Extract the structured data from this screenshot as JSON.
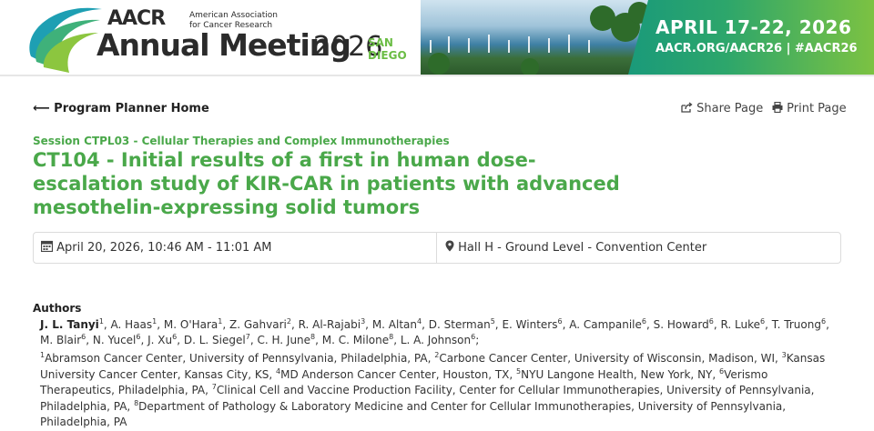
{
  "banner": {
    "org_short": "AACR",
    "org_full_line1": "American Association",
    "org_full_line2": "for Cancer Research",
    "meeting": "Annual Meeting",
    "year": "2026",
    "city_line1": "SAN",
    "city_line2": "DIEGO",
    "dates": "APRIL 17-22, 2026",
    "links": "AACR.ORG/AACR26  |  #AACR26"
  },
  "nav": {
    "home_label": "Program Planner Home",
    "share_label": "Share Page",
    "print_label": "Print Page"
  },
  "session": "Session CTPL03 - Cellular Therapies and Complex Immunotherapies",
  "title": "CT104 - Initial results of a first in human dose-escalation study of KIR-CAR in patients with advanced mesothelin-expressing solid tumors",
  "info": {
    "datetime": "April 20, 2026, 10:46 AM - 11:01 AM",
    "location": "Hall H - Ground Level - Convention Center"
  },
  "authors_heading": "Authors",
  "authors": [
    {
      "name": "J. L. Tanyi",
      "aff": "1"
    },
    {
      "name": "A. Haas",
      "aff": "1"
    },
    {
      "name": "M. O'Hara",
      "aff": "1"
    },
    {
      "name": "Z. Gahvari",
      "aff": "2"
    },
    {
      "name": "R. Al-Rajabi",
      "aff": "3"
    },
    {
      "name": "M. Altan",
      "aff": "4"
    },
    {
      "name": "D. Sterman",
      "aff": "5"
    },
    {
      "name": "E. Winters",
      "aff": "6"
    },
    {
      "name": "A. Campanile",
      "aff": "6"
    },
    {
      "name": "S. Howard",
      "aff": "6"
    },
    {
      "name": "R. Luke",
      "aff": "6"
    },
    {
      "name": "T. Truong",
      "aff": "6"
    },
    {
      "name": "M. Blair",
      "aff": "6"
    },
    {
      "name": "N. Yucel",
      "aff": "6"
    },
    {
      "name": "J. Xu",
      "aff": "6"
    },
    {
      "name": "D. L. Siegel",
      "aff": "7"
    },
    {
      "name": "C. H. June",
      "aff": "8"
    },
    {
      "name": "M. C. Milone",
      "aff": "8"
    },
    {
      "name": "L. A. Johnson",
      "aff": "6"
    }
  ],
  "affiliations": [
    {
      "n": "1",
      "text": "Abramson Cancer Center, University of Pennsylvania, Philadelphia, PA"
    },
    {
      "n": "2",
      "text": "Carbone Cancer Center, University of Wisconsin, Madison, WI"
    },
    {
      "n": "3",
      "text": "Kansas University Cancer Center, Kansas City, KS"
    },
    {
      "n": "4",
      "text": "MD Anderson Cancer Center, Houston, TX"
    },
    {
      "n": "5",
      "text": "NYU Langone Health, New York, NY"
    },
    {
      "n": "6",
      "text": "Verismo Therapeutics, Philadelphia, PA"
    },
    {
      "n": "7",
      "text": "Clinical Cell and Vaccine Production Facility, Center for Cellular Immunotherapies, University of Pennsylvania, Philadelphia, PA"
    },
    {
      "n": "8",
      "text": "Department of Pathology & Laboratory Medicine and Center for Cellular Immunotherapies, University of Pennsylvania, Philadelphia, PA"
    }
  ],
  "icons": {
    "back": "arrow-left-icon",
    "share": "share-icon",
    "print": "print-icon",
    "calendar": "calendar-icon",
    "location": "map-pin-icon"
  },
  "colors": {
    "accent_green": "#4aa84a",
    "banner_green_start": "#1a9a7a",
    "banner_green_end": "#7cc242"
  }
}
